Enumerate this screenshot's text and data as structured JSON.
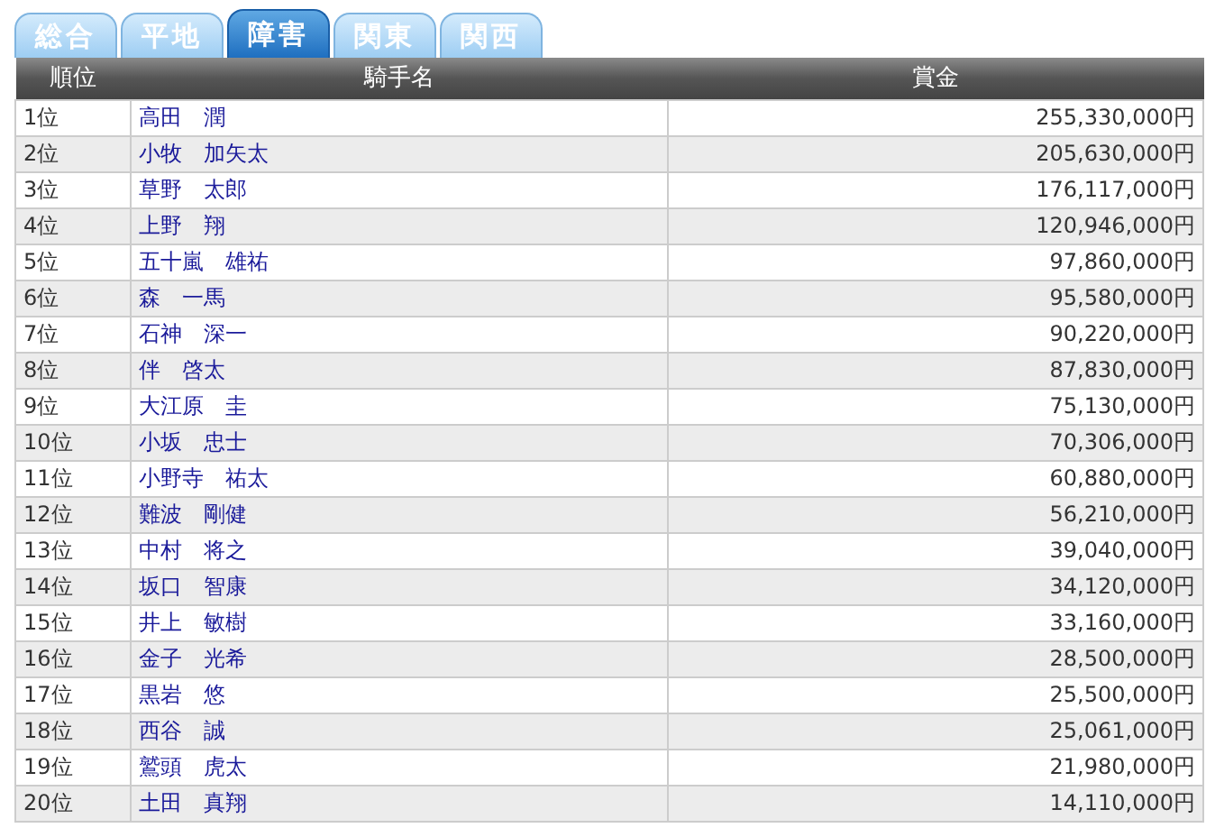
{
  "tabs": [
    {
      "label": "総合",
      "selected": false
    },
    {
      "label": "平地",
      "selected": false
    },
    {
      "label": "障害",
      "selected": true
    },
    {
      "label": "関東",
      "selected": false
    },
    {
      "label": "関西",
      "selected": false
    }
  ],
  "table": {
    "columns": [
      "順位",
      "騎手名",
      "賞金"
    ],
    "rows": [
      [
        "1位",
        "高田　潤",
        "255,330,000円"
      ],
      [
        "2位",
        "小牧　加矢太",
        "205,630,000円"
      ],
      [
        "3位",
        "草野　太郎",
        "176,117,000円"
      ],
      [
        "4位",
        "上野　翔",
        "120,946,000円"
      ],
      [
        "5位",
        "五十嵐　雄祐",
        "97,860,000円"
      ],
      [
        "6位",
        "森　一馬",
        "95,580,000円"
      ],
      [
        "7位",
        "石神　深一",
        "90,220,000円"
      ],
      [
        "8位",
        "伴　啓太",
        "87,830,000円"
      ],
      [
        "9位",
        "大江原　圭",
        "75,130,000円"
      ],
      [
        "10位",
        "小坂　忠士",
        "70,306,000円"
      ],
      [
        "11位",
        "小野寺　祐太",
        "60,880,000円"
      ],
      [
        "12位",
        "難波　剛健",
        "56,210,000円"
      ],
      [
        "13位",
        "中村　将之",
        "39,040,000円"
      ],
      [
        "14位",
        "坂口　智康",
        "34,120,000円"
      ],
      [
        "15位",
        "井上　敏樹",
        "33,160,000円"
      ],
      [
        "16位",
        "金子　光希",
        "28,500,000円"
      ],
      [
        "17位",
        "黒岩　悠",
        "25,500,000円"
      ],
      [
        "18位",
        "西谷　誠",
        "25,061,000円"
      ],
      [
        "19位",
        "鷲頭　虎太",
        "21,980,000円"
      ],
      [
        "20位",
        "土田　真翔",
        "14,110,000円"
      ]
    ]
  }
}
